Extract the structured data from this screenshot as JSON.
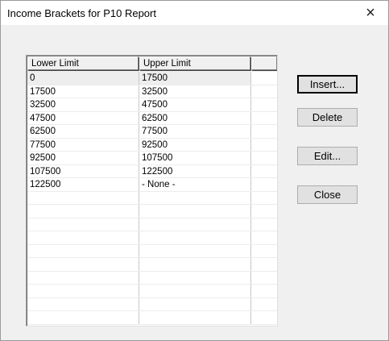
{
  "window": {
    "title": "Income Brackets for P10 Report",
    "close_glyph": "×"
  },
  "table": {
    "columns": [
      "Lower Limit",
      "Upper Limit",
      ""
    ],
    "rows": [
      [
        "0",
        "17500"
      ],
      [
        "17500",
        "32500"
      ],
      [
        "32500",
        "47500"
      ],
      [
        "47500",
        "62500"
      ],
      [
        "62500",
        "77500"
      ],
      [
        "77500",
        "92500"
      ],
      [
        "92500",
        "107500"
      ],
      [
        "107500",
        "122500"
      ],
      [
        "122500",
        "- None -"
      ],
      [
        "",
        ""
      ],
      [
        "",
        ""
      ],
      [
        "",
        ""
      ],
      [
        "",
        ""
      ],
      [
        "",
        ""
      ],
      [
        "",
        ""
      ],
      [
        "",
        ""
      ],
      [
        "",
        ""
      ],
      [
        "",
        ""
      ],
      [
        "",
        ""
      ]
    ],
    "selected_row": 0
  },
  "buttons": {
    "insert": "Insert...",
    "delete": "Delete",
    "edit": "Edit...",
    "close": "Close"
  }
}
